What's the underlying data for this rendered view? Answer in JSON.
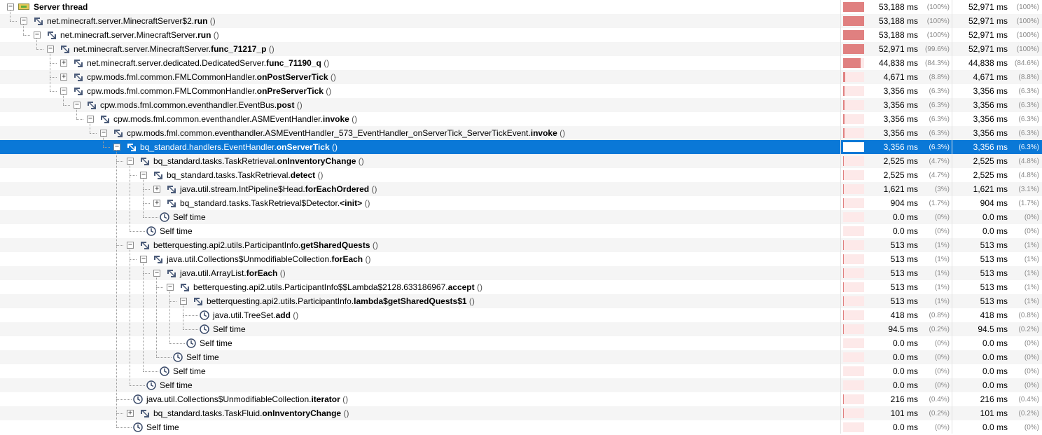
{
  "rows": [
    {
      "depth": 0,
      "expander": "minus",
      "icon": "thread-icon",
      "prefix": "",
      "bold": "Server thread",
      "suffix": "",
      "total": "53,188 ms",
      "total_pct": "(100%)",
      "self": "52,971 ms",
      "self_pct": "(100%)",
      "fraction": 1.0
    },
    {
      "depth": 1,
      "expander": "minus",
      "icon": "method-icon",
      "prefix": "net.minecraft.server.MinecraftServer$2.",
      "bold": "run",
      "suffix": " ()",
      "total": "53,188 ms",
      "total_pct": "(100%)",
      "self": "52,971 ms",
      "self_pct": "(100%)",
      "fraction": 1.0
    },
    {
      "depth": 2,
      "expander": "minus",
      "icon": "method-icon",
      "prefix": "net.minecraft.server.MinecraftServer.",
      "bold": "run",
      "suffix": " ()",
      "total": "53,188 ms",
      "total_pct": "(100%)",
      "self": "52,971 ms",
      "self_pct": "(100%)",
      "fraction": 1.0
    },
    {
      "depth": 3,
      "expander": "minus",
      "icon": "method-icon",
      "prefix": "net.minecraft.server.MinecraftServer.",
      "bold": "func_71217_p",
      "suffix": " ()",
      "total": "52,971 ms",
      "total_pct": "(99.6%)",
      "self": "52,971 ms",
      "self_pct": "(100%)",
      "fraction": 0.996
    },
    {
      "depth": 4,
      "expander": "plus",
      "icon": "method-icon",
      "prefix": "net.minecraft.server.dedicated.DedicatedServer.",
      "bold": "func_71190_q",
      "suffix": " ()",
      "total": "44,838 ms",
      "total_pct": "(84.3%)",
      "self": "44,838 ms",
      "self_pct": "(84.6%)",
      "fraction": 0.843
    },
    {
      "depth": 4,
      "expander": "plus",
      "icon": "method-icon",
      "prefix": "cpw.mods.fml.common.FMLCommonHandler.",
      "bold": "onPostServerTick",
      "suffix": " ()",
      "total": "4,671 ms",
      "total_pct": "(8.8%)",
      "self": "4,671 ms",
      "self_pct": "(8.8%)",
      "fraction": 0.088
    },
    {
      "depth": 4,
      "expander": "minus",
      "icon": "method-icon",
      "prefix": "cpw.mods.fml.common.FMLCommonHandler.",
      "bold": "onPreServerTick",
      "suffix": " ()",
      "total": "3,356 ms",
      "total_pct": "(6.3%)",
      "self": "3,356 ms",
      "self_pct": "(6.3%)",
      "fraction": 0.063
    },
    {
      "depth": 5,
      "expander": "minus",
      "icon": "method-icon",
      "prefix": "cpw.mods.fml.common.eventhandler.EventBus.",
      "bold": "post",
      "suffix": " ()",
      "total": "3,356 ms",
      "total_pct": "(6.3%)",
      "self": "3,356 ms",
      "self_pct": "(6.3%)",
      "fraction": 0.063
    },
    {
      "depth": 6,
      "expander": "minus",
      "icon": "method-icon",
      "prefix": "cpw.mods.fml.common.eventhandler.ASMEventHandler.",
      "bold": "invoke",
      "suffix": " ()",
      "total": "3,356 ms",
      "total_pct": "(6.3%)",
      "self": "3,356 ms",
      "self_pct": "(6.3%)",
      "fraction": 0.063
    },
    {
      "depth": 7,
      "expander": "minus",
      "icon": "method-icon",
      "prefix": "cpw.mods.fml.common.eventhandler.ASMEventHandler_573_EventHandler_onServerTick_ServerTickEvent.",
      "bold": "invoke",
      "suffix": " ()",
      "total": "3,356 ms",
      "total_pct": "(6.3%)",
      "self": "3,356 ms",
      "self_pct": "(6.3%)",
      "fraction": 0.063
    },
    {
      "depth": 8,
      "expander": "minus",
      "icon": "method-icon",
      "prefix": "bq_standard.handlers.EventHandler.",
      "bold": "onServerTick",
      "suffix": " ()",
      "total": "3,356 ms",
      "total_pct": "(6.3%)",
      "self": "3,356 ms",
      "self_pct": "(6.3%)",
      "fraction": 0.063,
      "selected": true
    },
    {
      "depth": 9,
      "expander": "minus",
      "icon": "method-icon",
      "prefix": "bq_standard.tasks.TaskRetrieval.",
      "bold": "onInventoryChange",
      "suffix": " ()",
      "total": "2,525 ms",
      "total_pct": "(4.7%)",
      "self": "2,525 ms",
      "self_pct": "(4.8%)",
      "fraction": 0.047
    },
    {
      "depth": 10,
      "expander": "minus",
      "icon": "method-icon",
      "prefix": "bq_standard.tasks.TaskRetrieval.",
      "bold": "detect",
      "suffix": " ()",
      "total": "2,525 ms",
      "total_pct": "(4.7%)",
      "self": "2,525 ms",
      "self_pct": "(4.8%)",
      "fraction": 0.047
    },
    {
      "depth": 11,
      "expander": "plus",
      "icon": "method-icon",
      "prefix": "java.util.stream.IntPipeline$Head.",
      "bold": "forEachOrdered",
      "suffix": " ()",
      "total": "1,621 ms",
      "total_pct": "(3%)",
      "self": "1,621 ms",
      "self_pct": "(3.1%)",
      "fraction": 0.03
    },
    {
      "depth": 11,
      "expander": "plus",
      "icon": "method-icon",
      "prefix": "bq_standard.tasks.TaskRetrieval$Detector.",
      "bold": "<init>",
      "suffix": " ()",
      "total": "904 ms",
      "total_pct": "(1.7%)",
      "self": "904 ms",
      "self_pct": "(1.7%)",
      "fraction": 0.017
    },
    {
      "depth": 11,
      "expander": "none",
      "icon": "clock-icon",
      "prefix": "",
      "bold": "",
      "plain": "Self time",
      "suffix": "",
      "total": "0.0 ms",
      "total_pct": "(0%)",
      "self": "0.0 ms",
      "self_pct": "(0%)",
      "fraction": 0.0
    },
    {
      "depth": 10,
      "expander": "none",
      "icon": "clock-icon",
      "prefix": "",
      "bold": "",
      "plain": "Self time",
      "suffix": "",
      "total": "0.0 ms",
      "total_pct": "(0%)",
      "self": "0.0 ms",
      "self_pct": "(0%)",
      "fraction": 0.0
    },
    {
      "depth": 9,
      "expander": "minus",
      "icon": "method-icon",
      "prefix": "betterquesting.api2.utils.ParticipantInfo.",
      "bold": "getSharedQuests",
      "suffix": " ()",
      "total": "513 ms",
      "total_pct": "(1%)",
      "self": "513 ms",
      "self_pct": "(1%)",
      "fraction": 0.01
    },
    {
      "depth": 10,
      "expander": "minus",
      "icon": "method-icon",
      "prefix": "java.util.Collections$UnmodifiableCollection.",
      "bold": "forEach",
      "suffix": " ()",
      "total": "513 ms",
      "total_pct": "(1%)",
      "self": "513 ms",
      "self_pct": "(1%)",
      "fraction": 0.01
    },
    {
      "depth": 11,
      "expander": "minus",
      "icon": "method-icon",
      "prefix": "java.util.ArrayList.",
      "bold": "forEach",
      "suffix": " ()",
      "total": "513 ms",
      "total_pct": "(1%)",
      "self": "513 ms",
      "self_pct": "(1%)",
      "fraction": 0.01
    },
    {
      "depth": 12,
      "expander": "minus",
      "icon": "method-icon",
      "prefix": "betterquesting.api2.utils.ParticipantInfo$$Lambda$2128.633186967.",
      "bold": "accept",
      "suffix": " ()",
      "total": "513 ms",
      "total_pct": "(1%)",
      "self": "513 ms",
      "self_pct": "(1%)",
      "fraction": 0.01
    },
    {
      "depth": 13,
      "expander": "minus",
      "icon": "method-icon",
      "prefix": "betterquesting.api2.utils.ParticipantInfo.",
      "bold": "lambda$getSharedQuests$1",
      "suffix": " ()",
      "total": "513 ms",
      "total_pct": "(1%)",
      "self": "513 ms",
      "self_pct": "(1%)",
      "fraction": 0.01
    },
    {
      "depth": 14,
      "expander": "none",
      "icon": "clock-icon",
      "prefix": "java.util.TreeSet.",
      "bold": "add",
      "suffix": " ()",
      "total": "418 ms",
      "total_pct": "(0.8%)",
      "self": "418 ms",
      "self_pct": "(0.8%)",
      "fraction": 0.008
    },
    {
      "depth": 14,
      "expander": "none",
      "icon": "clock-icon",
      "prefix": "",
      "bold": "",
      "plain": "Self time",
      "suffix": "",
      "total": "94.5 ms",
      "total_pct": "(0.2%)",
      "self": "94.5 ms",
      "self_pct": "(0.2%)",
      "fraction": 0.002
    },
    {
      "depth": 13,
      "expander": "none",
      "icon": "clock-icon",
      "prefix": "",
      "bold": "",
      "plain": "Self time",
      "suffix": "",
      "total": "0.0 ms",
      "total_pct": "(0%)",
      "self": "0.0 ms",
      "self_pct": "(0%)",
      "fraction": 0.0
    },
    {
      "depth": 12,
      "expander": "none",
      "icon": "clock-icon",
      "prefix": "",
      "bold": "",
      "plain": "Self time",
      "suffix": "",
      "total": "0.0 ms",
      "total_pct": "(0%)",
      "self": "0.0 ms",
      "self_pct": "(0%)",
      "fraction": 0.0
    },
    {
      "depth": 11,
      "expander": "none",
      "icon": "clock-icon",
      "prefix": "",
      "bold": "",
      "plain": "Self time",
      "suffix": "",
      "total": "0.0 ms",
      "total_pct": "(0%)",
      "self": "0.0 ms",
      "self_pct": "(0%)",
      "fraction": 0.0
    },
    {
      "depth": 10,
      "expander": "none",
      "icon": "clock-icon",
      "prefix": "",
      "bold": "",
      "plain": "Self time",
      "suffix": "",
      "total": "0.0 ms",
      "total_pct": "(0%)",
      "self": "0.0 ms",
      "self_pct": "(0%)",
      "fraction": 0.0
    },
    {
      "depth": 9,
      "expander": "none",
      "icon": "clock-icon",
      "prefix": "java.util.Collections$UnmodifiableCollection.",
      "bold": "iterator",
      "suffix": " ()",
      "total": "216 ms",
      "total_pct": "(0.4%)",
      "self": "216 ms",
      "self_pct": "(0.4%)",
      "fraction": 0.004
    },
    {
      "depth": 9,
      "expander": "plus",
      "icon": "method-icon",
      "prefix": "bq_standard.tasks.TaskFluid.",
      "bold": "onInventoryChange",
      "suffix": " ()",
      "total": "101 ms",
      "total_pct": "(0.2%)",
      "self": "101 ms",
      "self_pct": "(0.2%)",
      "fraction": 0.002
    },
    {
      "depth": 9,
      "expander": "none",
      "icon": "clock-icon",
      "prefix": "",
      "bold": "",
      "plain": "Self time",
      "suffix": "",
      "total": "0.0 ms",
      "total_pct": "(0%)",
      "self": "0.0 ms",
      "self_pct": "(0%)",
      "fraction": 0.0
    }
  ],
  "colors": {
    "selection": "#0a78d7",
    "bar_fill": "#e08080",
    "bar_track": "#fde9e9",
    "method_icon": "#4a5a78",
    "clock_icon": "#3b4b6a"
  }
}
